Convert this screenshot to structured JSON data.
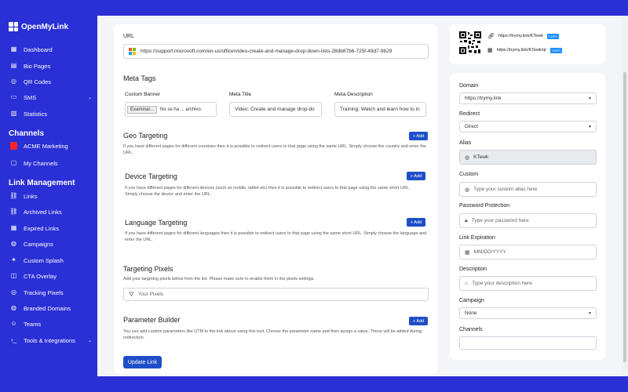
{
  "brand": {
    "name": "OpenMyLink"
  },
  "sidebar": {
    "items_top": [
      {
        "label": "Dashboard",
        "icon": "grid-icon"
      },
      {
        "label": "Bio Pages",
        "icon": "layout-icon"
      },
      {
        "label": "QR Codes",
        "icon": "qr-icon"
      },
      {
        "label": "SMS",
        "icon": "sms-icon"
      },
      {
        "label": "Statistics",
        "icon": "chart-icon"
      }
    ],
    "channels_title": "Channels",
    "channels": [
      {
        "label": "ACME Marketing"
      },
      {
        "label": "My Channels"
      }
    ],
    "link_mgmt_title": "Link Management",
    "link_items": [
      {
        "label": "Links"
      },
      {
        "label": "Archived Links"
      },
      {
        "label": "Expired Links"
      },
      {
        "label": "Campaigns"
      },
      {
        "label": "Custom Splash"
      },
      {
        "label": "CTA Overlay"
      },
      {
        "label": "Tracking Pixels"
      },
      {
        "label": "Branded Domains"
      },
      {
        "label": "Teams"
      },
      {
        "label": "Tools & Integrations"
      }
    ]
  },
  "main": {
    "url_label": "URL",
    "url_value": "https://support.microsoft.com/en-us/office/video-create-and-manage-drop-down-lists-28db87b6-725f-49d7-9b29",
    "meta_title": "Meta Tags",
    "custom_banner_label": "Custom Banner",
    "custom_banner_btn": "Examinar...",
    "custom_banner_value": "No se ha ... archivo.",
    "meta_title_label": "Meta Title",
    "meta_title_value": "Video: Create and manage drop-do",
    "meta_desc_label": "Meta Description",
    "meta_desc_value": "Training: Watch and learn how to in",
    "geo_title": "Geo Targeting",
    "geo_desc": "If you have different pages for different countries then it is possible to redirect users to that page using the same URL. Simply choose the country and enter the URL.",
    "device_title": "Device Targeting",
    "device_desc": "If you have different pages for different devices (such as mobile, tablet etc) then it is possible to redirect users to that page using the same short URL. Simply choose the device and enter the URL.",
    "lang_title": "Language Targeting",
    "lang_desc": "If you have different pages for different languages then it is possible to redirect users to that page using the same short URL. Simply choose the language and enter the URL.",
    "pixels_title": "Targeting Pixels",
    "pixels_desc": "Add your targeting pixels below from the list. Please make sure to enable them in the pixels settings.",
    "pixels_placeholder": "Your Pixels",
    "param_title": "Parameter Builder",
    "param_desc": "You can add custom parameters like UTM to the link above using this tool. Choose the parameter name and then assign a value. These will be added during redirection.",
    "add_label": "+ Add",
    "update_btn": "Update Link"
  },
  "qr": {
    "link1": "https://trymy.link/KTewk",
    "link2": "https://trymy.link/KTewk/qr",
    "copy": "COPY"
  },
  "side": {
    "domain_label": "Domain",
    "domain_value": "https://trymy.link",
    "redirect_label": "Redirect",
    "redirect_value": "Direct",
    "alias_label": "Alias",
    "alias_value": "KTewk",
    "custom_label": "Custom",
    "custom_placeholder": "Type your custom alias here",
    "password_label": "Password Protection",
    "password_placeholder": "Type your password here",
    "expiration_label": "Link Expiration",
    "expiration_placeholder": "MM/DD/YYYY",
    "description_label": "Description",
    "description_placeholder": "Type your description here",
    "campaign_label": "Campaign",
    "campaign_value": "None",
    "channels_label": "Channels"
  },
  "colors": {
    "brand": "#2a2fd6",
    "primary": "#1f4fc8",
    "acme": "#ff2222"
  }
}
